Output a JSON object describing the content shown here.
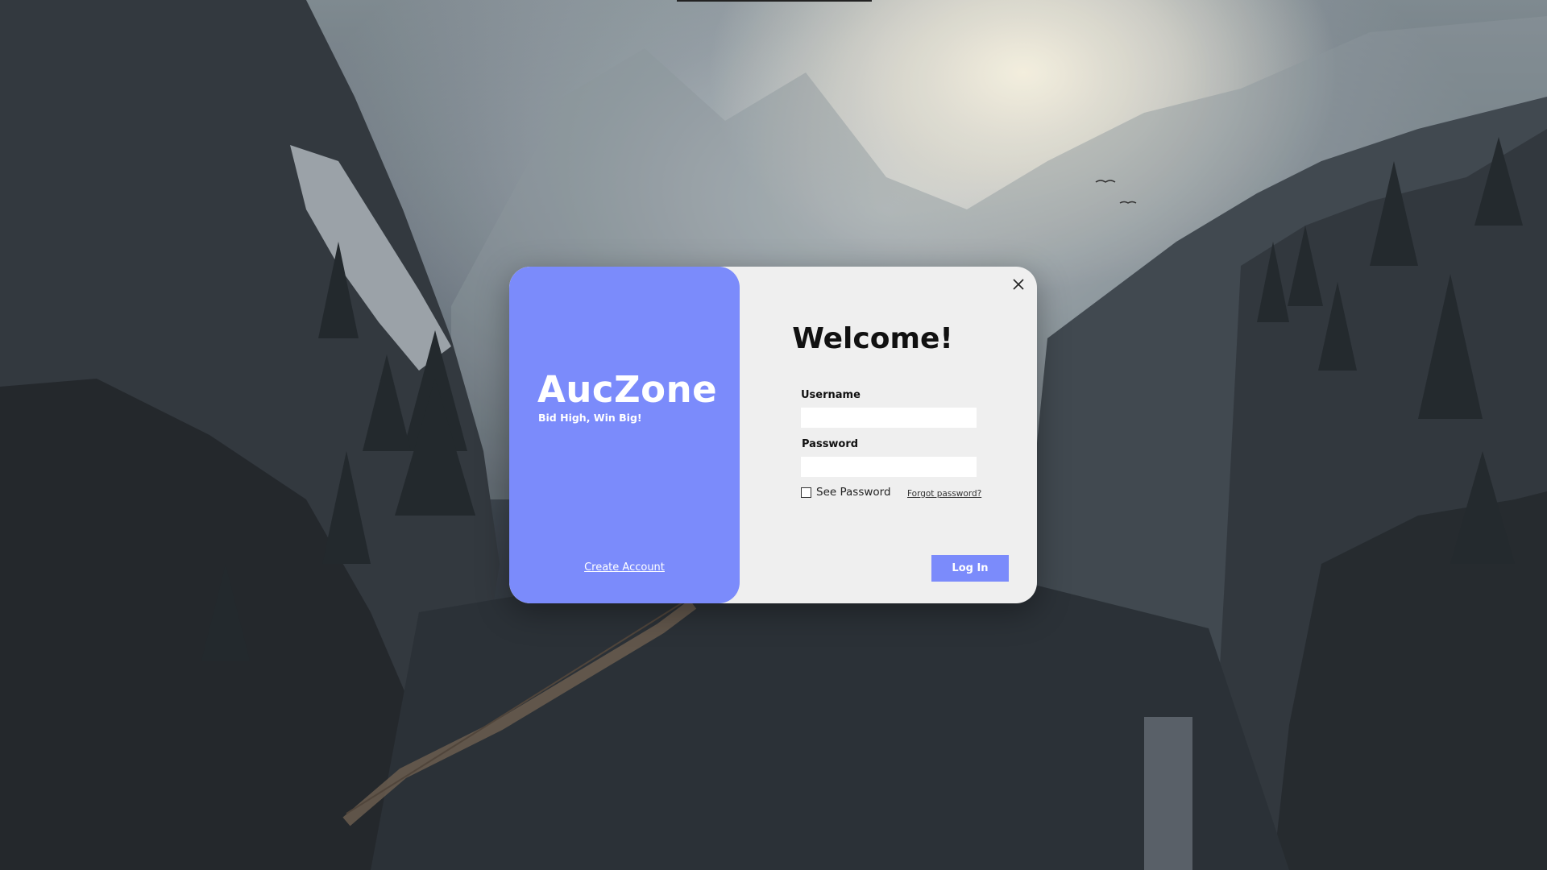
{
  "brand": {
    "name": "AucZone",
    "tagline": "Bid High, Win Big!",
    "create_account_label": "Create Account",
    "accent_color": "#7b8bfb"
  },
  "dialog": {
    "welcome": "Welcome!",
    "close_icon": "close-icon"
  },
  "form": {
    "username_label": "Username",
    "username_value": "",
    "password_label": "Password",
    "password_value": "",
    "see_password_label": "See Password",
    "see_password_checked": false,
    "forgot_password_label": "Forgot password?",
    "login_label": "Log In"
  }
}
